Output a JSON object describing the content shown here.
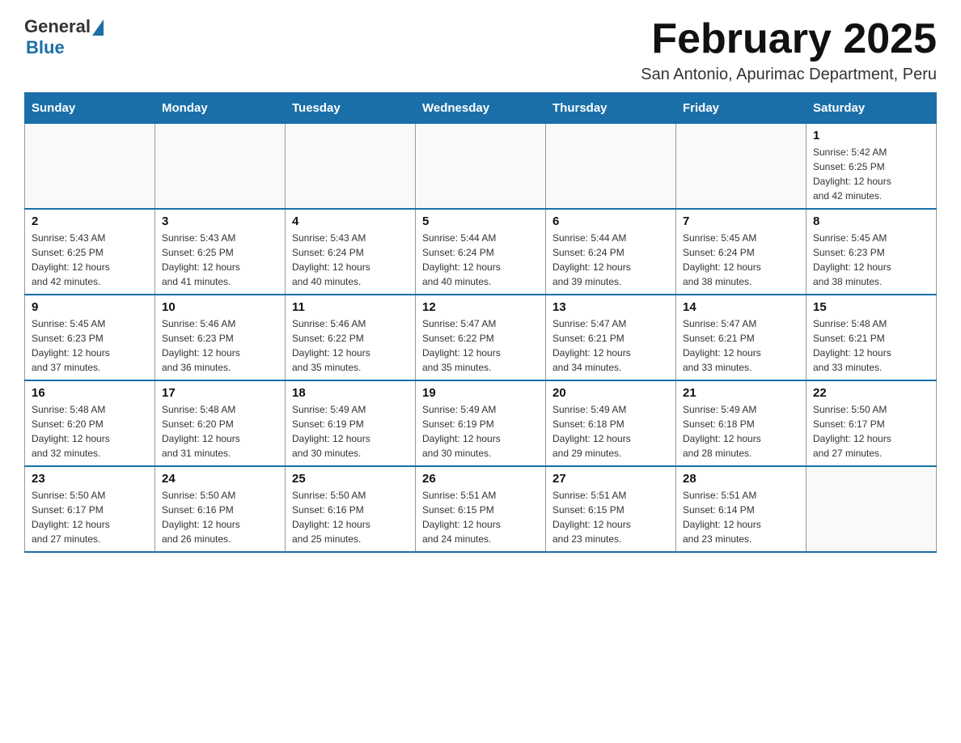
{
  "header": {
    "logo_general": "General",
    "logo_blue": "Blue",
    "month_title": "February 2025",
    "location": "San Antonio, Apurimac Department, Peru"
  },
  "weekdays": [
    "Sunday",
    "Monday",
    "Tuesday",
    "Wednesday",
    "Thursday",
    "Friday",
    "Saturday"
  ],
  "weeks": [
    [
      {
        "day": "",
        "info": ""
      },
      {
        "day": "",
        "info": ""
      },
      {
        "day": "",
        "info": ""
      },
      {
        "day": "",
        "info": ""
      },
      {
        "day": "",
        "info": ""
      },
      {
        "day": "",
        "info": ""
      },
      {
        "day": "1",
        "info": "Sunrise: 5:42 AM\nSunset: 6:25 PM\nDaylight: 12 hours\nand 42 minutes."
      }
    ],
    [
      {
        "day": "2",
        "info": "Sunrise: 5:43 AM\nSunset: 6:25 PM\nDaylight: 12 hours\nand 42 minutes."
      },
      {
        "day": "3",
        "info": "Sunrise: 5:43 AM\nSunset: 6:25 PM\nDaylight: 12 hours\nand 41 minutes."
      },
      {
        "day": "4",
        "info": "Sunrise: 5:43 AM\nSunset: 6:24 PM\nDaylight: 12 hours\nand 40 minutes."
      },
      {
        "day": "5",
        "info": "Sunrise: 5:44 AM\nSunset: 6:24 PM\nDaylight: 12 hours\nand 40 minutes."
      },
      {
        "day": "6",
        "info": "Sunrise: 5:44 AM\nSunset: 6:24 PM\nDaylight: 12 hours\nand 39 minutes."
      },
      {
        "day": "7",
        "info": "Sunrise: 5:45 AM\nSunset: 6:24 PM\nDaylight: 12 hours\nand 38 minutes."
      },
      {
        "day": "8",
        "info": "Sunrise: 5:45 AM\nSunset: 6:23 PM\nDaylight: 12 hours\nand 38 minutes."
      }
    ],
    [
      {
        "day": "9",
        "info": "Sunrise: 5:45 AM\nSunset: 6:23 PM\nDaylight: 12 hours\nand 37 minutes."
      },
      {
        "day": "10",
        "info": "Sunrise: 5:46 AM\nSunset: 6:23 PM\nDaylight: 12 hours\nand 36 minutes."
      },
      {
        "day": "11",
        "info": "Sunrise: 5:46 AM\nSunset: 6:22 PM\nDaylight: 12 hours\nand 35 minutes."
      },
      {
        "day": "12",
        "info": "Sunrise: 5:47 AM\nSunset: 6:22 PM\nDaylight: 12 hours\nand 35 minutes."
      },
      {
        "day": "13",
        "info": "Sunrise: 5:47 AM\nSunset: 6:21 PM\nDaylight: 12 hours\nand 34 minutes."
      },
      {
        "day": "14",
        "info": "Sunrise: 5:47 AM\nSunset: 6:21 PM\nDaylight: 12 hours\nand 33 minutes."
      },
      {
        "day": "15",
        "info": "Sunrise: 5:48 AM\nSunset: 6:21 PM\nDaylight: 12 hours\nand 33 minutes."
      }
    ],
    [
      {
        "day": "16",
        "info": "Sunrise: 5:48 AM\nSunset: 6:20 PM\nDaylight: 12 hours\nand 32 minutes."
      },
      {
        "day": "17",
        "info": "Sunrise: 5:48 AM\nSunset: 6:20 PM\nDaylight: 12 hours\nand 31 minutes."
      },
      {
        "day": "18",
        "info": "Sunrise: 5:49 AM\nSunset: 6:19 PM\nDaylight: 12 hours\nand 30 minutes."
      },
      {
        "day": "19",
        "info": "Sunrise: 5:49 AM\nSunset: 6:19 PM\nDaylight: 12 hours\nand 30 minutes."
      },
      {
        "day": "20",
        "info": "Sunrise: 5:49 AM\nSunset: 6:18 PM\nDaylight: 12 hours\nand 29 minutes."
      },
      {
        "day": "21",
        "info": "Sunrise: 5:49 AM\nSunset: 6:18 PM\nDaylight: 12 hours\nand 28 minutes."
      },
      {
        "day": "22",
        "info": "Sunrise: 5:50 AM\nSunset: 6:17 PM\nDaylight: 12 hours\nand 27 minutes."
      }
    ],
    [
      {
        "day": "23",
        "info": "Sunrise: 5:50 AM\nSunset: 6:17 PM\nDaylight: 12 hours\nand 27 minutes."
      },
      {
        "day": "24",
        "info": "Sunrise: 5:50 AM\nSunset: 6:16 PM\nDaylight: 12 hours\nand 26 minutes."
      },
      {
        "day": "25",
        "info": "Sunrise: 5:50 AM\nSunset: 6:16 PM\nDaylight: 12 hours\nand 25 minutes."
      },
      {
        "day": "26",
        "info": "Sunrise: 5:51 AM\nSunset: 6:15 PM\nDaylight: 12 hours\nand 24 minutes."
      },
      {
        "day": "27",
        "info": "Sunrise: 5:51 AM\nSunset: 6:15 PM\nDaylight: 12 hours\nand 23 minutes."
      },
      {
        "day": "28",
        "info": "Sunrise: 5:51 AM\nSunset: 6:14 PM\nDaylight: 12 hours\nand 23 minutes."
      },
      {
        "day": "",
        "info": ""
      }
    ]
  ]
}
